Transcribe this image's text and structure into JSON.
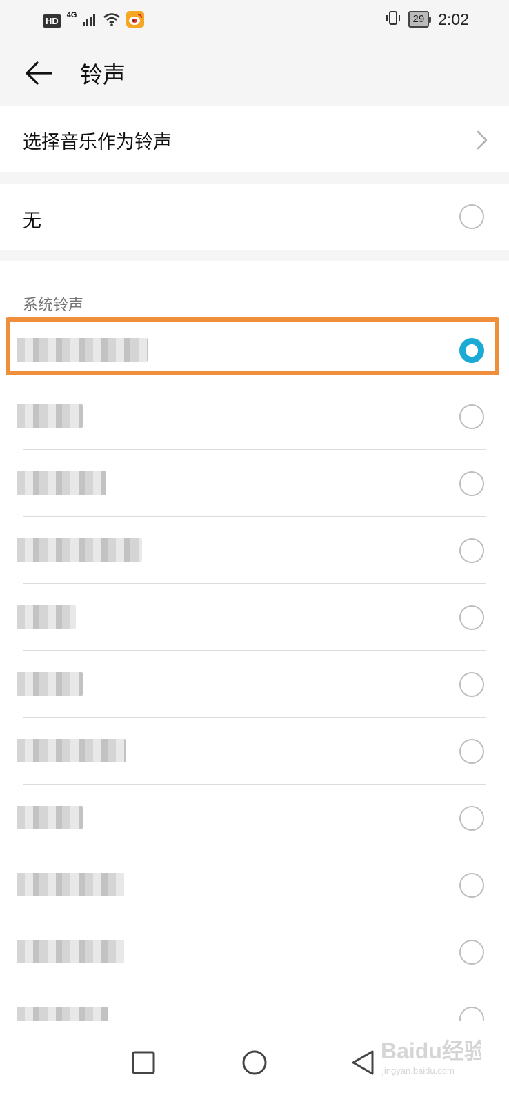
{
  "status_bar": {
    "hd": "HD",
    "network": "4G",
    "battery": "29",
    "time": "2:02",
    "icons": [
      "signal-icon",
      "wifi-icon",
      "weibo-icon",
      "vibrate-icon",
      "battery-icon"
    ]
  },
  "header": {
    "title": "铃声",
    "back_icon": "arrow-left-icon"
  },
  "choose_music": {
    "label": "选择音乐作为铃声",
    "icon": "chevron-right-icon"
  },
  "none_option": {
    "label": "无",
    "selected": false
  },
  "system_ringtones": {
    "header": "系统铃声",
    "selected_index": 0,
    "items_count_visible": 11
  },
  "navigation": {
    "icons": [
      "recents-square-icon",
      "home-circle-icon",
      "back-triangle-icon"
    ]
  },
  "watermark": {
    "text": "Baidu经验",
    "subtext": "jingyan.baidu.com"
  },
  "colors": {
    "accent": "#1aaad4",
    "highlight": "#ef8f3c",
    "background": "#f5f5f5"
  }
}
